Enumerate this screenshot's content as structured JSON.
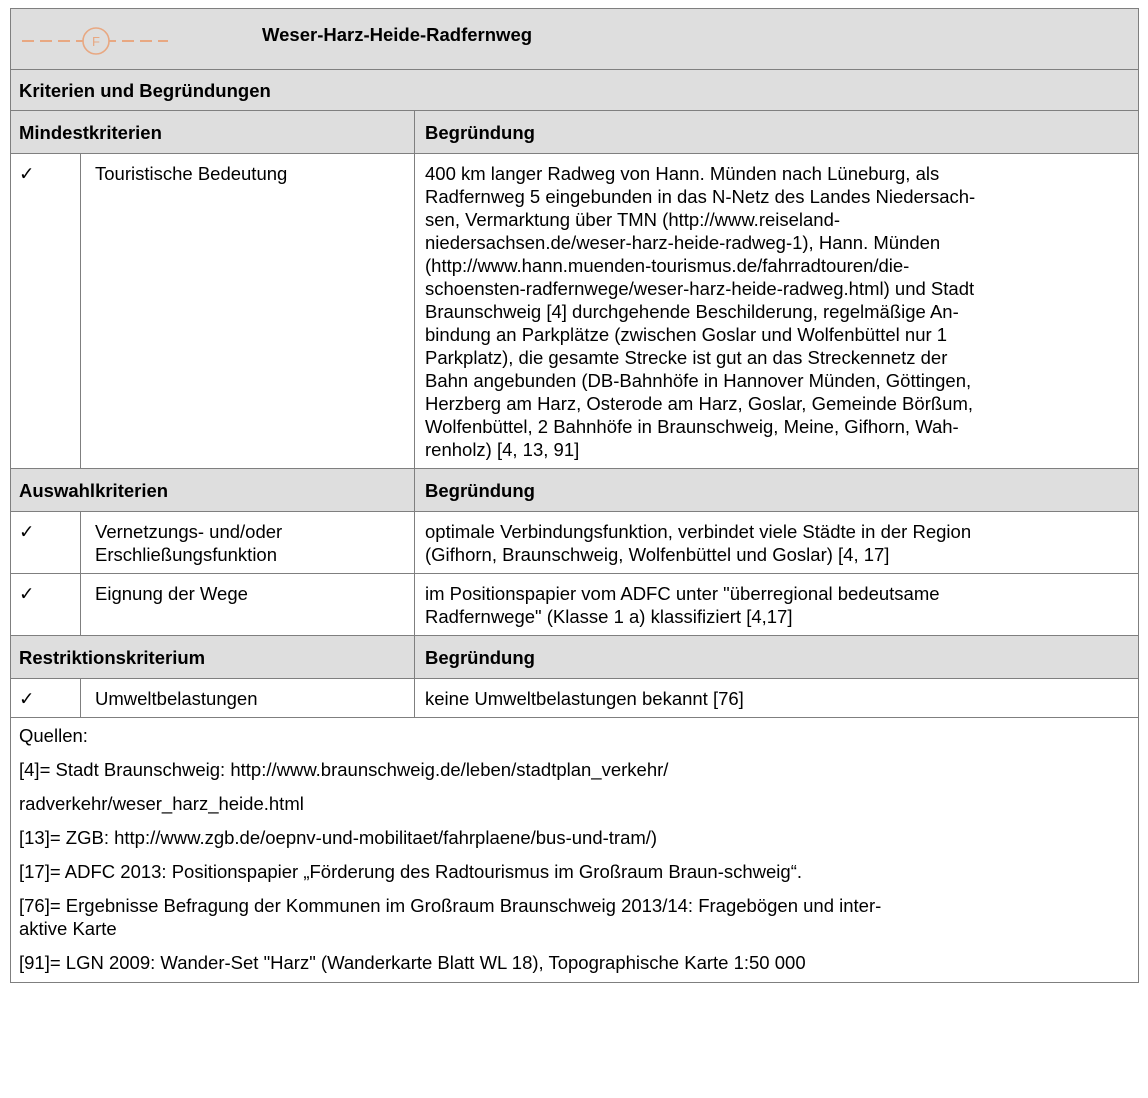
{
  "header": {
    "logo_letter": "F",
    "title": "Weser-Harz-Heide-Radfernweg"
  },
  "section_title": "Kriterien und Begründungen",
  "groups": [
    {
      "heading": "Mindestkriterien",
      "reason_heading": "Begründung",
      "rows": [
        {
          "check": "✓",
          "criterion": "Touristische Bedeutung",
          "reason_lines": [
            "400 km langer Radweg von Hann. Münden nach Lüneburg, als",
            "Radfernweg 5 eingebunden in das N-Netz des Landes Niedersach-",
            "sen, Vermarktung über TMN (http://www.reiseland-",
            "niedersachsen.de/weser-harz-heide-radweg-1), Hann. Münden",
            "(http://www.hann.muenden-tourismus.de/fahrradtouren/die-",
            "schoensten-radfernwege/weser-harz-heide-radweg.html) und Stadt",
            "Braunschweig [4] durchgehende Beschilderung, regelmäßige An-",
            "bindung an Parkplätze (zwischen Goslar und Wolfenbüttel nur 1",
            "Parkplatz), die gesamte Strecke ist gut an das Streckennetz der",
            "Bahn angebunden (DB-Bahnhöfe in Hannover Münden, Göttingen,",
            "Herzberg am Harz, Osterode am Harz, Goslar, Gemeinde Börßum,",
            "Wolfenbüttel, 2 Bahnhöfe in Braunschweig, Meine, Gifhorn, Wah-",
            "renholz) [4, 13, 91]"
          ]
        }
      ]
    },
    {
      "heading": "Auswahlkriterien",
      "reason_heading": "Begründung",
      "rows": [
        {
          "check": "✓",
          "criterion_lines": [
            "Vernetzungs- und/oder",
            "Erschließungsfunktion"
          ],
          "reason_lines": [
            "optimale Verbindungsfunktion, verbindet viele Städte in der Region",
            "(Gifhorn, Braunschweig, Wolfenbüttel und Goslar) [4, 17]"
          ]
        },
        {
          "check": "✓",
          "criterion": "Eignung der Wege",
          "reason_lines": [
            "im Positionspapier vom ADFC unter \"überregional bedeutsame",
            "Radfernwege\" (Klasse 1 a) klassifiziert [4,17]"
          ]
        }
      ]
    },
    {
      "heading": "Restriktionskriterium",
      "reason_heading": "Begründung",
      "rows": [
        {
          "check": "✓",
          "criterion": "Umweltbelastungen",
          "reason_lines": [
            "keine Umweltbelastungen bekannt [76]"
          ]
        }
      ]
    }
  ],
  "sources": [
    "Quellen:",
    "[4]= Stadt Braunschweig: http://www.braunschweig.de/leben/stadtplan_verkehr/",
    "radverkehr/weser_harz_heide.html",
    "[13]= ZGB: http://www.zgb.de/oepnv-und-mobilitaet/fahrplaene/bus-und-tram/)",
    "[17]= ADFC 2013: Positionspapier „Förderung des Radtourismus im Großraum Braun-schweig“.",
    "[76]= Ergebnisse Befragung der Kommunen im Großraum Braunschweig 2013/14: Fragebögen und inter-",
    "aktive Karte",
    "[91]= LGN 2009: Wander-Set \"Harz\" (Wanderkarte Blatt WL 18), Topographische Karte 1:50 000"
  ],
  "colors": {
    "header_bg": "#dedede",
    "border": "#7f7f7f",
    "logo_line": "#e8a882"
  }
}
